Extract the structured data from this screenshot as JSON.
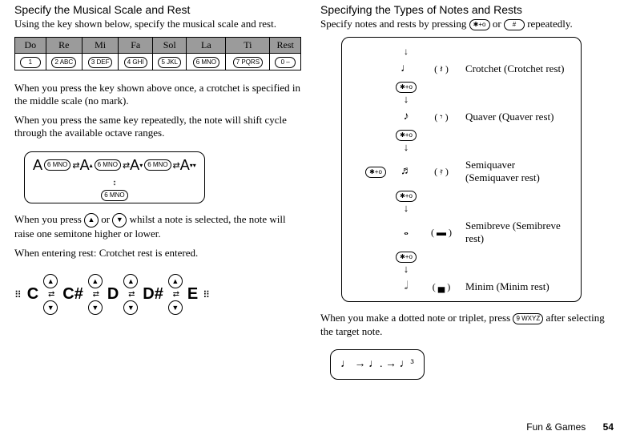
{
  "left": {
    "title": "Specify the Musical Scale and Rest",
    "intro": "Using the key shown below, specify the musical scale and rest.",
    "headers": [
      "Do",
      "Re",
      "Mi",
      "Fa",
      "Sol",
      "La",
      "Ti",
      "Rest"
    ],
    "keys": [
      "1",
      "2 ABC",
      "3 DEF",
      "4 GHI",
      "5 JKL",
      "6 MNO",
      "7 PQRS",
      "0 ‒"
    ],
    "p2": "When you press the key shown above once, a crotchet is specified in the middle scale (no mark).",
    "p3": "When you press the same key repeatedly, the note will shift cycle through the available octave ranges.",
    "oct_key": "6 MNO",
    "p4a": "When you press ",
    "p4b": " or ",
    "p4c": " whilst a note is selected, the note will raise one semitone higher or lower.",
    "up": "▲",
    "down": "▼",
    "p5": "When entering rest: Crotchet rest is entered.",
    "seq": [
      "C",
      "C#",
      "D",
      "D#",
      "E"
    ]
  },
  "right": {
    "title": "Specifying the Types of Notes and Rests",
    "intro_a": "Specify notes and rests by pressing ",
    "intro_b": " or ",
    "intro_c": " repeatedly.",
    "key_star": "✱+o",
    "key_hash": "#",
    "cycle": [
      {
        "note": "♩",
        "rest": "𝄽",
        "label": "Crotchet (Crotchet rest)"
      },
      {
        "note": "♪",
        "rest": "𝄾",
        "label": "Quaver (Quaver rest)"
      },
      {
        "note": "♬",
        "rest": "𝄿",
        "label": "Semiquaver (Semiquaver rest)"
      },
      {
        "note": "𝅝",
        "rest": "▬",
        "label": "Semibreve (Semibreve rest)"
      },
      {
        "note": "𝅗𝅥",
        "rest": "▄",
        "label": "Minim (Minim rest)"
      }
    ],
    "p2a": "When you make a dotted note or triplet, press ",
    "p2b": " after selecting the target note.",
    "key_nine": "9 WXYZ",
    "triplet_seq": "♩ → ♩. → ♩³"
  },
  "footer": {
    "section": "Fun & Games",
    "page": "54"
  }
}
